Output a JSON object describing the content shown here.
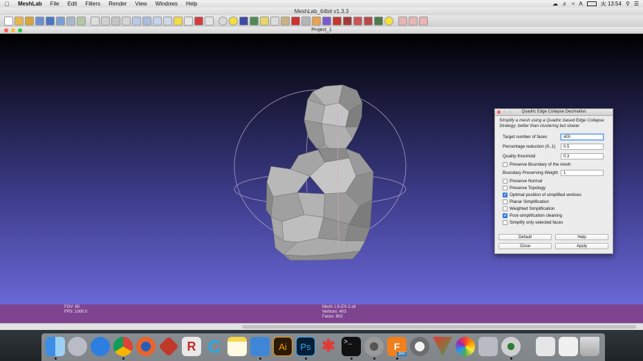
{
  "menubar": {
    "app": "MeshLab",
    "items": [
      "File",
      "Edit",
      "Filters",
      "Render",
      "View",
      "Windows",
      "Help"
    ],
    "ime": "A",
    "clock": "火 13:54"
  },
  "window_title": "MeshLab_64bit v1.3.3",
  "subwindow_title": "Project_1",
  "dialog": {
    "title": "Quadric Edge Collapse Decimation",
    "description": "Simplify a mesh using a Quadric based Edge Collapse Strategy; better than clustering but slower",
    "fields": [
      {
        "label": "Target number of faces",
        "value": "400"
      },
      {
        "label": "Percentage reduction (0..1)",
        "value": "0.5"
      },
      {
        "label": "Quality threshold",
        "value": "0.3"
      }
    ],
    "preserve_boundary": {
      "label": "Preserve Boundary of the mesh",
      "checked": false
    },
    "boundary_weight": {
      "label": "Boundary Preserving Weight",
      "value": "1"
    },
    "checkboxes": [
      {
        "label": "Preserve Normal",
        "checked": false
      },
      {
        "label": "Preserve Topology",
        "checked": false
      },
      {
        "label": "Optimal position of simplified vertices",
        "checked": true
      },
      {
        "label": "Planar Simplification",
        "checked": false
      },
      {
        "label": "Weighted Simplification",
        "checked": false
      },
      {
        "label": "Post-simplification cleaning",
        "checked": true
      },
      {
        "label": "Simplify only selected faces",
        "checked": false
      }
    ],
    "buttons": {
      "default": "Default",
      "help": "Help",
      "close": "Close",
      "apply": "Apply"
    }
  },
  "info": {
    "fov": "FOV: 60",
    "fps": "FPS:  1000.0",
    "mesh": "Mesh: LS-EX-2.stl",
    "vertices": "Vertices: 403",
    "faces": "Faces: 802"
  },
  "colors": {
    "viewport_top": "#000000",
    "viewport_bottom": "#6a68d6",
    "infobar": "#7e4490",
    "mesh": "#9a9a9a",
    "checkbox_on": "#3d86e8"
  },
  "dock_icons": [
    "finder-icon",
    "launchpad-icon",
    "safari-icon",
    "chrome-icon",
    "firefox-icon",
    "cube-app-icon",
    "r-app-icon",
    "c-app-icon",
    "notes-icon",
    "preview-icon",
    "illustrator-icon",
    "photoshop-icon",
    "spark-app-icon",
    "terminal-icon",
    "system-preferences-icon",
    "fusion360-icon",
    "sketchup-icon",
    "meshmixer-icon",
    "photos-icon",
    "box-3d-icon",
    "eye-app-icon",
    "usb-drive-icon",
    "screenshot-icon",
    "trash-icon"
  ],
  "dock_labels": {
    "illustrator": "Ai",
    "photoshop": "Ps",
    "fusion_badge": "360",
    "terminal": ">_"
  }
}
